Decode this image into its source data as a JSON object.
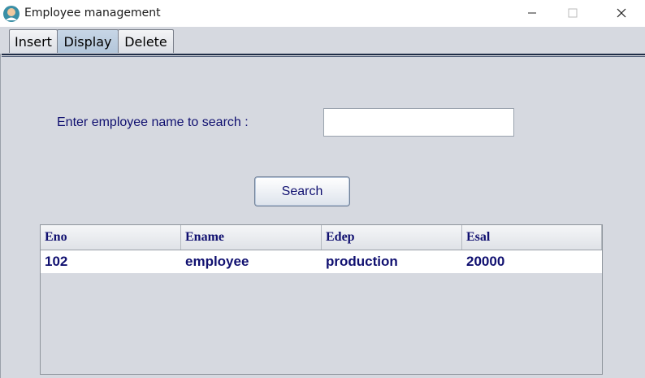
{
  "window": {
    "title": "Employee management",
    "app_icon": "person-avatar-icon",
    "controls": [
      "minimize-icon",
      "maximize-icon",
      "close-icon"
    ]
  },
  "tabs": [
    {
      "label": "Insert",
      "selected": false
    },
    {
      "label": "Display",
      "selected": true
    },
    {
      "label": "Delete",
      "selected": false
    }
  ],
  "search": {
    "label": "Enter employee name to search :",
    "value": "",
    "button_label": "Search"
  },
  "table": {
    "columns": [
      "Eno",
      "Ename",
      "Edep",
      "Esal"
    ],
    "rows": [
      [
        "102",
        "employee",
        "production",
        "20000"
      ]
    ]
  },
  "colors": {
    "background": "#d6d9e0",
    "text_accent": "#101070",
    "selected_tab": "#bccde0"
  }
}
